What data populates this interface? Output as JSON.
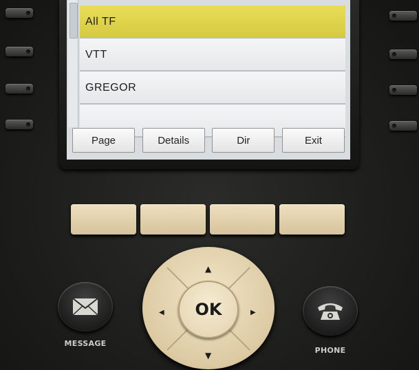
{
  "screen": {
    "list_items": [
      "All TF",
      "VTT",
      "GREGOR",
      ""
    ],
    "selected_index": 0,
    "softkeys": [
      "Page",
      "Details",
      "Dir",
      "Exit"
    ]
  },
  "hardware": {
    "ok_label": "OK",
    "message_label": "MESSAGE",
    "phone_label": "PHONE",
    "nav_arrows": {
      "up": "▲",
      "down": "▼",
      "left": "◀",
      "right": "▶"
    }
  },
  "colors": {
    "selection_highlight": "#e0d44c",
    "keycap": "#e3d2ae",
    "body": "#1e1e1c"
  }
}
